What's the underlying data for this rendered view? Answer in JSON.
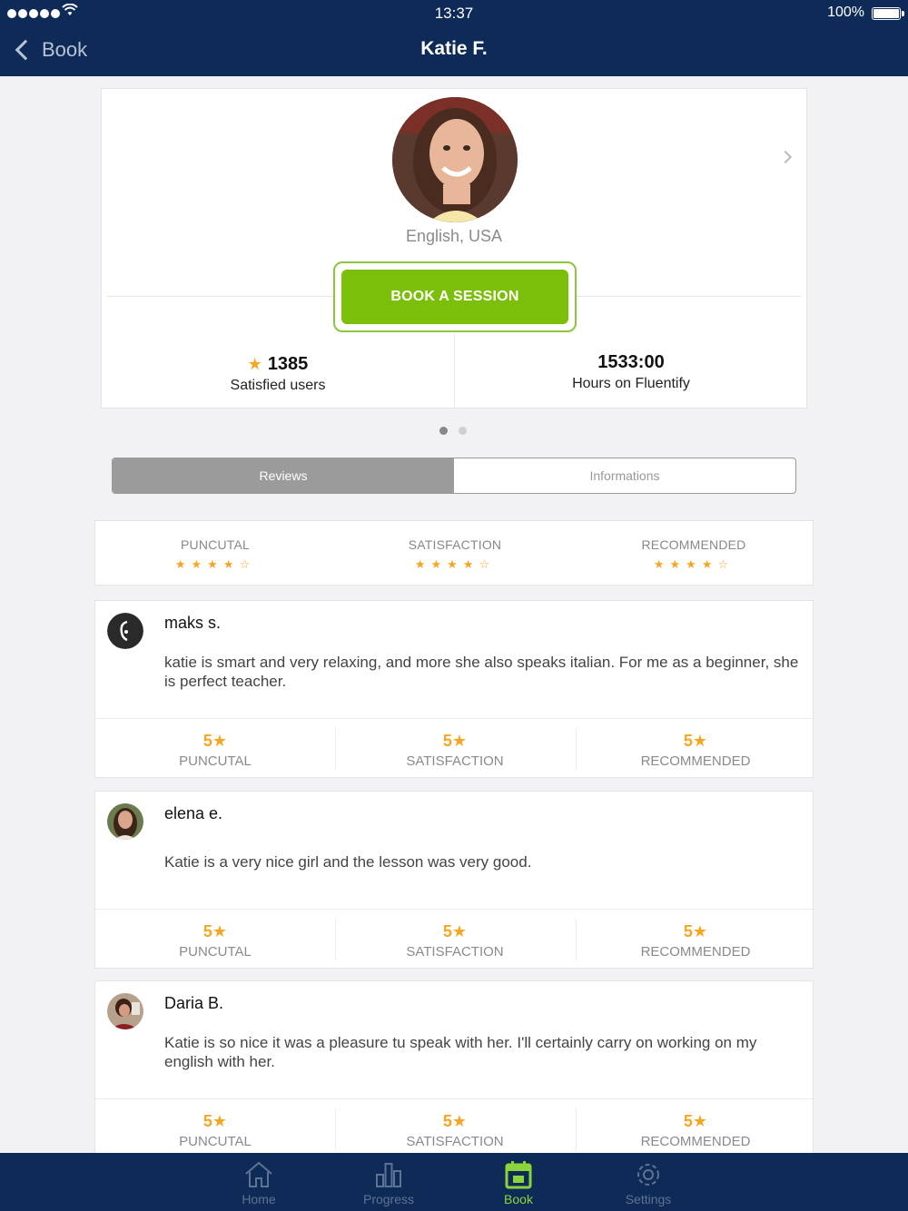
{
  "status_bar": {
    "time": "13:37",
    "battery": "100%"
  },
  "nav": {
    "back_label": "Book",
    "title": "Katie F."
  },
  "profile": {
    "language": "English, USA",
    "book_label": "BOOK A SESSION",
    "satisfied_count": "1385",
    "satisfied_label": "Satisfied users",
    "hours_value": "1533:00",
    "hours_label": "Hours on Fluentify"
  },
  "segments": {
    "reviews": "Reviews",
    "informations": "Informations",
    "active": "Reviews"
  },
  "summary": [
    {
      "label": "PUNCUTAL",
      "rating": 4,
      "max": 5
    },
    {
      "label": "SATISFACTION",
      "rating": 4,
      "max": 5
    },
    {
      "label": "RECOMMENDED",
      "rating": 4,
      "max": 5
    }
  ],
  "reviews": [
    {
      "name": "maks s.",
      "text": "katie is smart and very relaxing, and more she also speaks italian. For me as a beginner, she is perfect teacher.",
      "scores": [
        {
          "value": "5★",
          "label": "PUNCUTAL"
        },
        {
          "value": "5★",
          "label": "SATISFACTION"
        },
        {
          "value": "5★",
          "label": "RECOMMENDED"
        }
      ]
    },
    {
      "name": "elena e.",
      "text": "Katie is a very nice girl and the lesson was very good.",
      "scores": [
        {
          "value": "5★",
          "label": "PUNCUTAL"
        },
        {
          "value": "5★",
          "label": "SATISFACTION"
        },
        {
          "value": "5★",
          "label": "RECOMMENDED"
        }
      ]
    },
    {
      "name": "Daria B.",
      "text": "Katie is so nice it was a pleasure tu speak with her. I'll certainly  carry on working on my english with her.",
      "scores": [
        {
          "value": "5★",
          "label": "PUNCUTAL"
        },
        {
          "value": "5★",
          "label": "SATISFACTION"
        },
        {
          "value": "5★",
          "label": "RECOMMENDED"
        }
      ]
    }
  ],
  "tabbar": [
    {
      "label": "Home",
      "icon": "home-icon"
    },
    {
      "label": "Progress",
      "icon": "bar-chart-icon"
    },
    {
      "label": "Book",
      "icon": "calendar-icon",
      "active": true
    },
    {
      "label": "Settings",
      "icon": "gear-icon"
    }
  ],
  "colors": {
    "navy": "#0e2a56",
    "green": "#7bbf0a",
    "star": "#f5a623"
  }
}
